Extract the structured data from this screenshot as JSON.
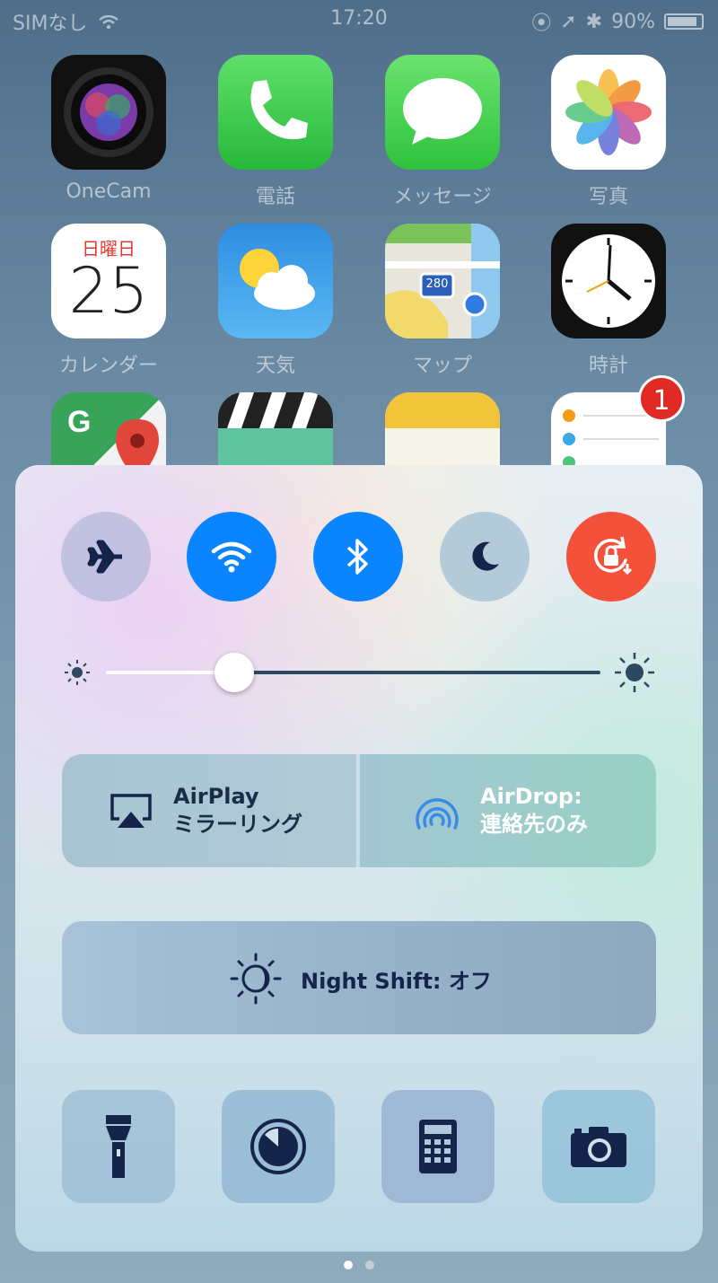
{
  "status_bar": {
    "carrier": "SIMなし",
    "time": "17:20",
    "battery": "90%",
    "battery_level": 0.9
  },
  "home_apps": [
    {
      "label": "OneCam"
    },
    {
      "label": "電話"
    },
    {
      "label": "メッセージ"
    },
    {
      "label": "写真"
    },
    {
      "label": "カレンダー",
      "weekday": "日曜日",
      "day": "25"
    },
    {
      "label": "天気"
    },
    {
      "label": "マップ",
      "shield": "280"
    },
    {
      "label": "時計"
    }
  ],
  "reminders_badge": "1",
  "control_center": {
    "toggles": [
      {
        "name": "airplane",
        "icon": "airplane-icon",
        "state": "off"
      },
      {
        "name": "wifi",
        "icon": "wifi-icon",
        "state": "on"
      },
      {
        "name": "bluetooth",
        "icon": "bluetooth-icon",
        "state": "on"
      },
      {
        "name": "do-not-disturb",
        "icon": "moon-icon",
        "state": "off"
      },
      {
        "name": "rotation-lock",
        "icon": "rotation-lock-icon",
        "state": "on"
      }
    ],
    "brightness": 0.26,
    "airplay": {
      "line1": "AirPlay",
      "line2": "ミラーリング"
    },
    "airdrop": {
      "line1": "AirDrop:",
      "line2": "連絡先のみ"
    },
    "night_shift": {
      "label": "Night Shift: オフ"
    },
    "shortcuts": [
      "flashlight-icon",
      "timer-icon",
      "calculator-icon",
      "camera-icon"
    ]
  },
  "page_indicator": {
    "count": 2,
    "current": 1
  },
  "colors": {
    "accent_blue": "#0a84ff",
    "rotation_red": "#f4513a",
    "icon_dark": "#14244a"
  }
}
